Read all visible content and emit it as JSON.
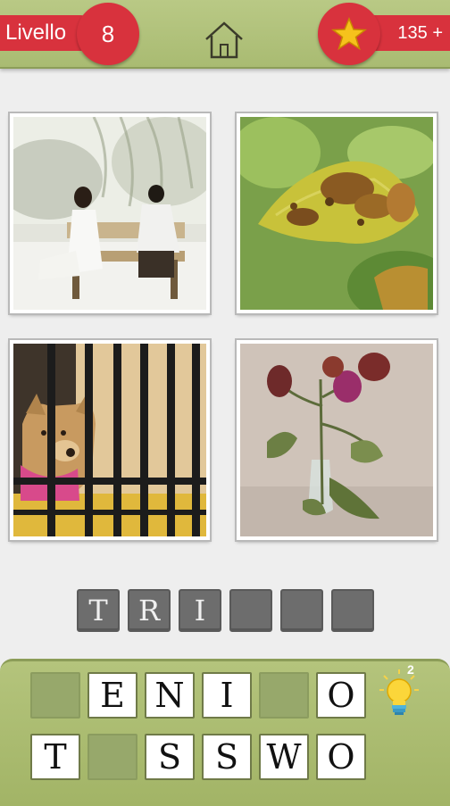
{
  "header": {
    "level_label": "Livello",
    "level_number": "8",
    "coins": "135 +",
    "home_icon": "home-icon",
    "star_icon": "star-icon"
  },
  "pictures": [
    {
      "subject": "couple-on-bench"
    },
    {
      "subject": "decaying-leaf"
    },
    {
      "subject": "dog-behind-bars"
    },
    {
      "subject": "wilted-roses"
    }
  ],
  "answer": {
    "slots": [
      "T",
      "R",
      "I",
      "",
      "",
      ""
    ]
  },
  "letters": {
    "row1": [
      "",
      "E",
      "N",
      "I",
      "",
      "O"
    ],
    "row2": [
      "T",
      "",
      "S",
      "S",
      "W",
      "O"
    ]
  },
  "hint": {
    "icon": "lightbulb-icon",
    "count": "2"
  },
  "colors": {
    "accent_red": "#d8323d",
    "header_green": "#aebf77",
    "slot_gray": "#6d6d6d",
    "star_yellow": "#f6c21c"
  }
}
